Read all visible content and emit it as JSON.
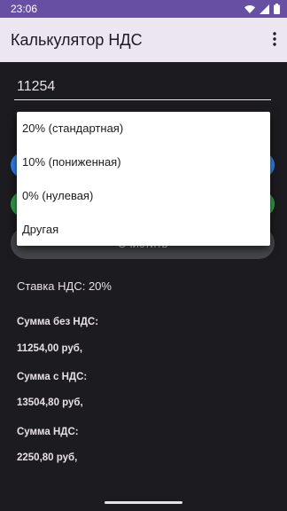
{
  "status_bar": {
    "time": "23:06",
    "icons": [
      "wifi-icon",
      "signal-icon",
      "battery-icon"
    ]
  },
  "app_bar": {
    "title": "Калькулятор НДС",
    "menu_icon": "more-vert-icon"
  },
  "amount_input": {
    "value": "11254"
  },
  "rate_dropdown": {
    "options": [
      "20% (стандартная)",
      "10% (пониженная)",
      "0% (нулевая)",
      "Другая"
    ]
  },
  "clear_button": {
    "label": "Очистить"
  },
  "results": {
    "rate_line": "Ставка НДС: 20%",
    "without_vat_label": "Сумма без НДС:",
    "without_vat_value": "11254,00 руб,",
    "with_vat_label": "Сумма с НДС:",
    "with_vat_value": "13504,80 руб,",
    "vat_label": "Сумма НДС:",
    "vat_value": "2250,80 руб,"
  },
  "colors": {
    "status_bar": "#6750a4",
    "app_bar": "#ece6f0",
    "background": "#1c1b1f",
    "blue_button": "#2f80ed",
    "green_button": "#2e9e48",
    "clear_button": "#45464c"
  }
}
